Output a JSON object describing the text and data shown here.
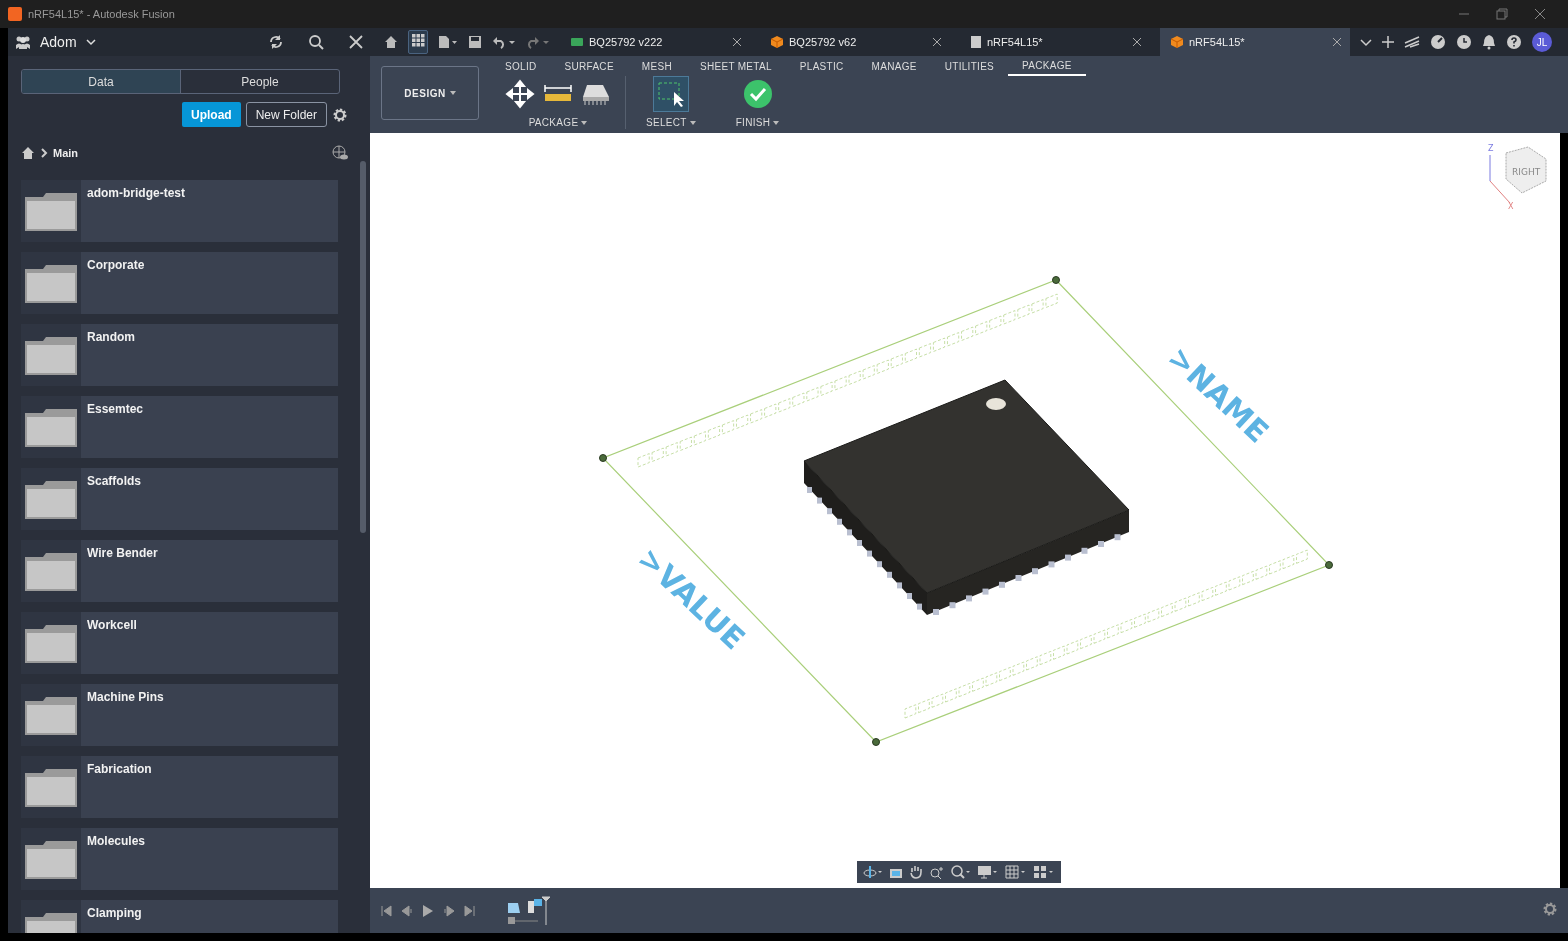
{
  "window": {
    "title": "nRF54L15* - Autodesk Fusion"
  },
  "data_panel": {
    "team": "Adom",
    "tabs": [
      {
        "label": "Data",
        "selected": true
      },
      {
        "label": "People",
        "selected": false
      }
    ],
    "upload": "Upload",
    "new_folder": "New Folder",
    "breadcrumb": "Main",
    "folders": [
      "adom-bridge-test",
      "Corporate",
      "Random",
      "Essemtec",
      "Scaffolds",
      "Wire Bender",
      "Workcell",
      "Machine Pins",
      "Fabrication",
      "Molecules",
      "Clamping"
    ]
  },
  "document_tabs": [
    {
      "title": "BQ25792 v222",
      "kind": "pcb",
      "selected": false
    },
    {
      "title": "BQ25792 v62",
      "kind": "part",
      "selected": false
    },
    {
      "title": "nRF54L15*",
      "kind": "sheet",
      "selected": false
    },
    {
      "title": "nRF54L15*",
      "kind": "part",
      "selected": true
    }
  ],
  "user": {
    "initials": "JL"
  },
  "ribbon": {
    "workspace": "DESIGN",
    "tabs": [
      {
        "label": "SOLID",
        "selected": false
      },
      {
        "label": "SURFACE",
        "selected": false
      },
      {
        "label": "MESH",
        "selected": false
      },
      {
        "label": "SHEET METAL",
        "selected": false
      },
      {
        "label": "PLASTIC",
        "selected": false
      },
      {
        "label": "MANAGE",
        "selected": false
      },
      {
        "label": "UTILITIES",
        "selected": false
      },
      {
        "label": "PACKAGE",
        "selected": true
      }
    ],
    "groups": [
      {
        "label": "PACKAGE",
        "kind": "package"
      },
      {
        "label": "SELECT",
        "kind": "select"
      },
      {
        "label": "FINISH",
        "kind": "finish"
      }
    ]
  },
  "viewport": {
    "labels": [
      ">NAME",
      ">VALUE"
    ],
    "viewcube": {
      "face": "RIGHT",
      "axes": [
        "Z",
        "X"
      ]
    }
  }
}
